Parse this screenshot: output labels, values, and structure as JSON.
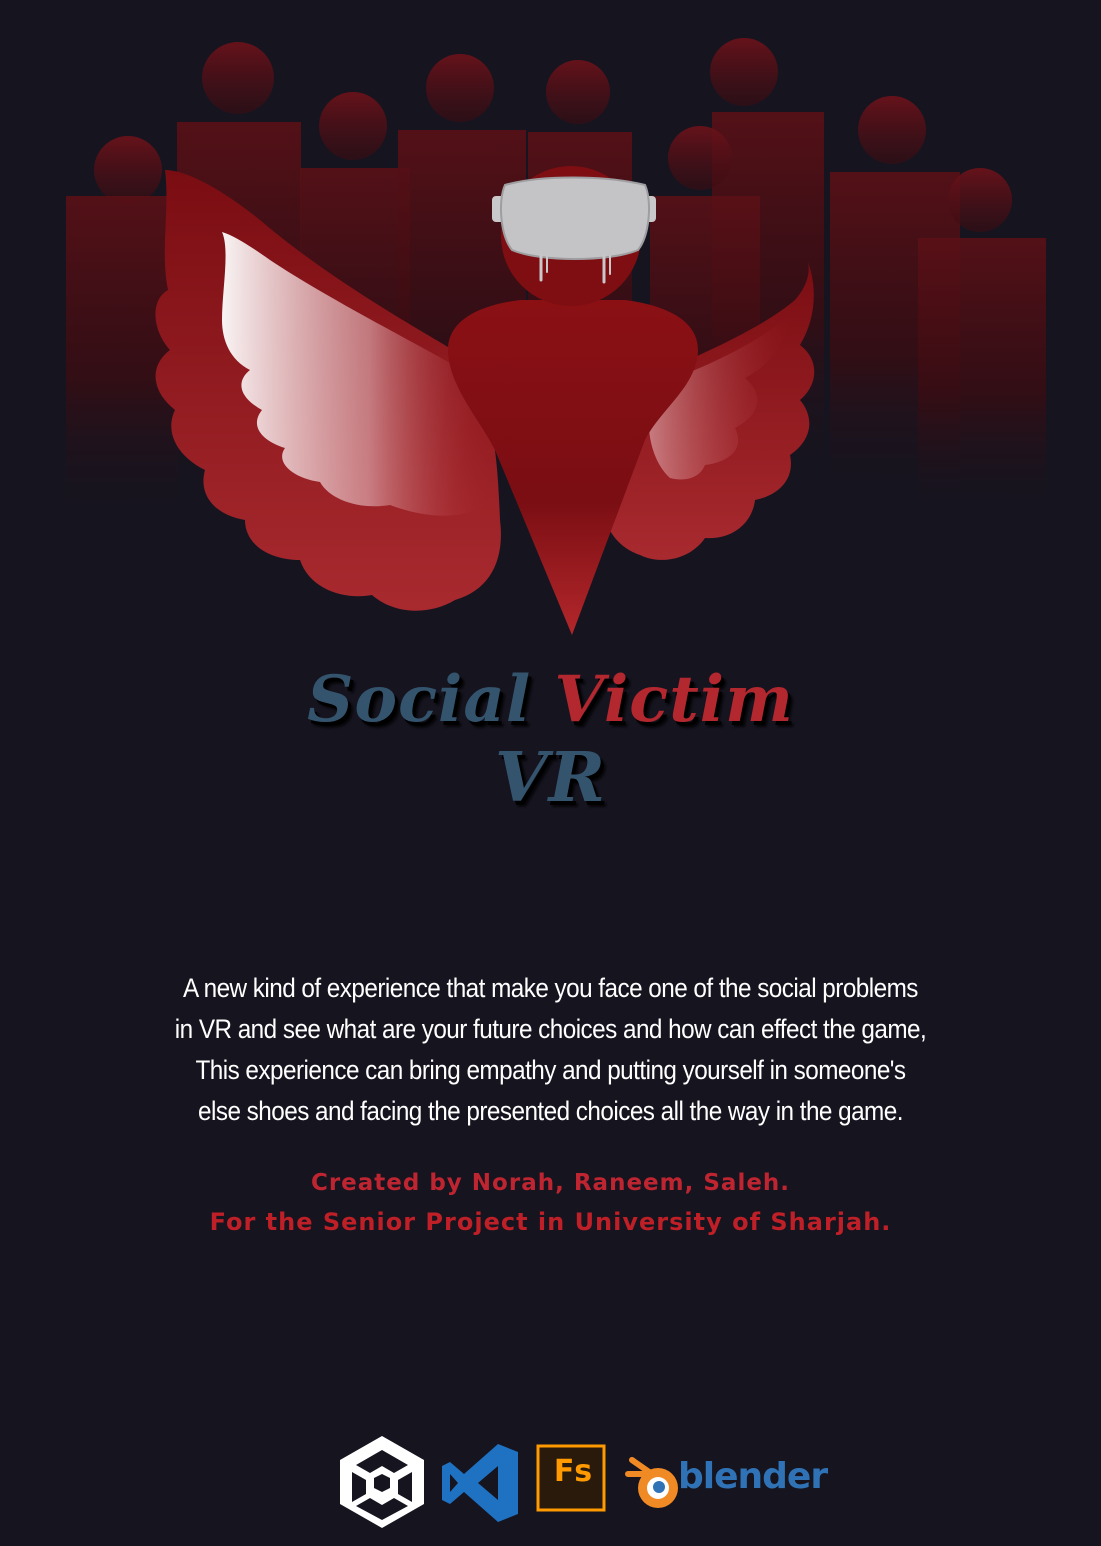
{
  "title": {
    "word1": "Social",
    "word2": "Victim",
    "word3": "VR"
  },
  "description": [
    "A new kind of experience that make you face one of the social problems",
    "in VR and see what are your future choices and how can effect the game,",
    "This experience can bring empathy and putting yourself in someone's",
    "else shoes and facing the presented choices all the way in the game."
  ],
  "credits": {
    "line1": "Created by Norah, Raneem, Saleh.",
    "line2": "For the Senior Project in University of Sharjah."
  },
  "tools": {
    "photoshop_label": "Fs",
    "blender_label": "blender"
  },
  "icons": [
    "unity-icon",
    "visual-studio-icon",
    "fuse-icon",
    "blender-icon"
  ],
  "colors": {
    "background": "#16141f",
    "title_blue": "#34546e",
    "title_red": "#b3272f",
    "credit_red": "#bf2531",
    "figure_red": "#8e1313"
  }
}
